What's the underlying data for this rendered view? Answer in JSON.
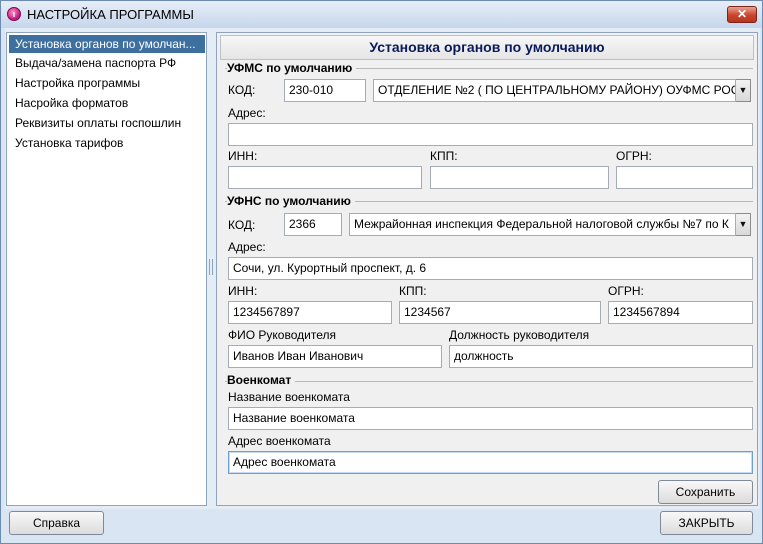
{
  "window": {
    "title": "НАСТРОЙКА ПРОГРАММЫ",
    "icon": "app-logo-icon",
    "close_symbol": "✕"
  },
  "nav": {
    "items": [
      {
        "label": "Установка органов по умолчан...",
        "selected": true
      },
      {
        "label": "Выдача/замена паспорта РФ",
        "selected": false
      },
      {
        "label": "Настройка программы",
        "selected": false
      },
      {
        "label": "Насройка форматов",
        "selected": false
      },
      {
        "label": "Реквизиты оплаты госпошлин",
        "selected": false
      },
      {
        "label": "Установка тарифов",
        "selected": false
      }
    ]
  },
  "panel": {
    "title": "Установка органов по умолчанию",
    "ufms": {
      "section_title": "УФМС по умолчанию",
      "code_label": "КОД:",
      "code_value": "230-010",
      "org_value": "ОТДЕЛЕНИЕ №2 ( ПО ЦЕНТРАЛЬНОМУ РАЙОНУ) ОУФМС РОС",
      "address_label": "Адрес:",
      "address_value": "",
      "inn_label": "ИНН:",
      "inn_value": "",
      "kpp_label": "КПП:",
      "kpp_value": "",
      "ogrn_label": "ОГРН:",
      "ogrn_value": ""
    },
    "ufns": {
      "section_title": "УФНС по умолчанию",
      "code_label": "КОД:",
      "code_value": "2366",
      "org_value": "Межрайонная инспекция Федеральной налоговой службы №7 по К",
      "address_label": "Адрес:",
      "address_value": "Сочи, ул. Курортный проспект, д. 6",
      "inn_label": "ИНН:",
      "inn_value": "1234567897",
      "kpp_label": "КПП:",
      "kpp_value": "1234567",
      "ogrn_label": "ОГРН:",
      "ogrn_value": "1234567894",
      "head_name_label": "ФИО Руководителя",
      "head_name_value": "Иванов Иван Иванович",
      "head_position_label": "Должность руководителя",
      "head_position_value": "должность"
    },
    "voenkomat": {
      "section_title": "Военкомат",
      "name_label": "Название военкомата",
      "name_value": "Название военкомата",
      "address_label": "Адрес военкомата",
      "address_value": "Адрес военкомата"
    },
    "save_button": "Сохранить",
    "combo_arrow": "▼"
  },
  "footer": {
    "help_button": "Справка",
    "close_button": "ЗАКРЫТЬ"
  },
  "colors": {
    "nav_selected_bg": "#3d6f9f",
    "header_text": "#0a1a5a",
    "close_button": "#c9442d"
  }
}
